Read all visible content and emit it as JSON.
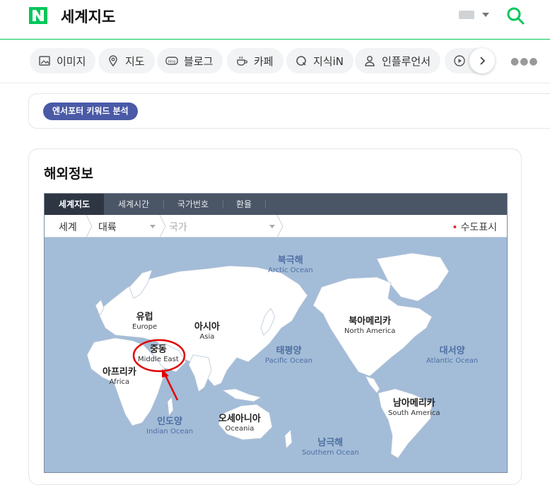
{
  "header": {
    "title": "세계지도",
    "accent_color": "#03c75a",
    "logo_letter": "N"
  },
  "tabs": [
    {
      "label": "이미지",
      "icon": "image-icon"
    },
    {
      "label": "지도",
      "icon": "map-pin-icon"
    },
    {
      "label": "블로그",
      "icon": "blog-icon"
    },
    {
      "label": "카페",
      "icon": "cafe-icon"
    },
    {
      "label": "지식iN",
      "icon": "question-icon"
    },
    {
      "label": "인플루언서",
      "icon": "person-icon"
    }
  ],
  "keyword_button": "엔서포터 키워드 분석",
  "section": {
    "title": "해외정보"
  },
  "widget": {
    "tabs": [
      "세계지도",
      "세계시간",
      "국가번호",
      "환율"
    ],
    "breadcrumb": {
      "root": "세계",
      "continent": "대륙",
      "country": "국가"
    },
    "capital_toggle": "수도표시",
    "labels": {
      "europe": {
        "ko": "유럽",
        "en": "Europe"
      },
      "asia": {
        "ko": "아시아",
        "en": "Asia"
      },
      "middle_east": {
        "ko": "중동",
        "en": "Middle East"
      },
      "africa": {
        "ko": "아프리카",
        "en": "Africa"
      },
      "oceania": {
        "ko": "오세아니아",
        "en": "Oceania"
      },
      "north_america": {
        "ko": "북아메리카",
        "en": "North America"
      },
      "south_america": {
        "ko": "남아메리카",
        "en": "South America"
      },
      "arctic": {
        "ko": "북극해",
        "en": "Arctic Ocean"
      },
      "pacific": {
        "ko": "태평양",
        "en": "Pacific Ocean"
      },
      "atlantic": {
        "ko": "대서양",
        "en": "Atlantic Ocean"
      },
      "indian": {
        "ko": "인도양",
        "en": "Indian Ocean"
      },
      "southern": {
        "ko": "남극해",
        "en": "Southern Ocean"
      }
    }
  },
  "colors": {
    "ocean": "#a3bcd8",
    "land": "#ffffff",
    "highlight": "#e10000",
    "keyword_button": "#4a5aa6"
  }
}
